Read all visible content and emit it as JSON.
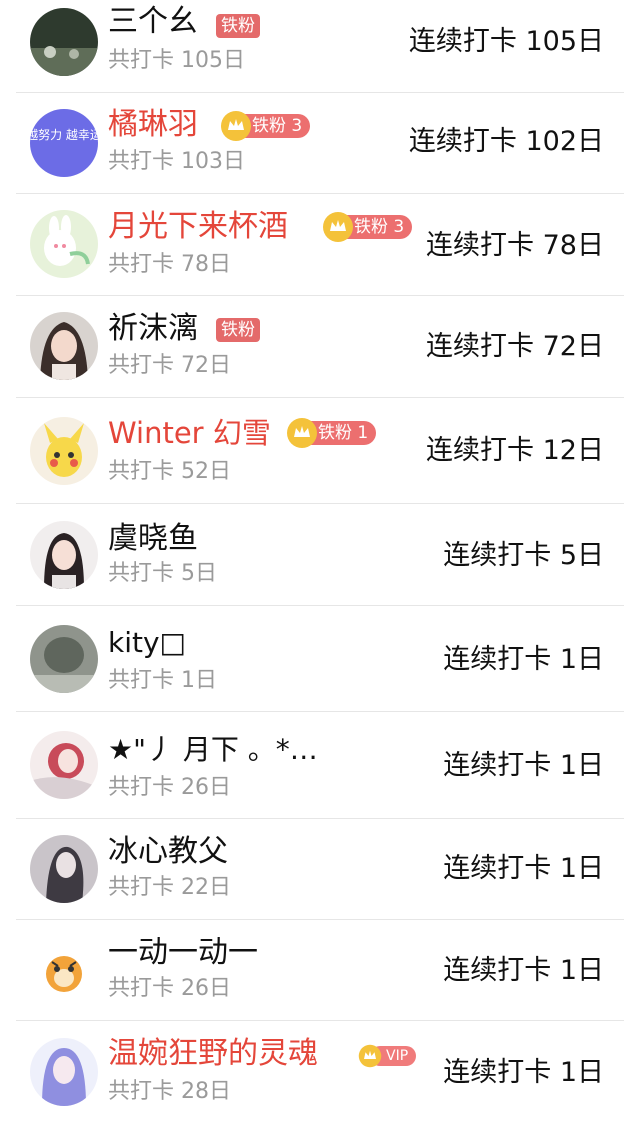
{
  "rows": [
    {
      "name": "三个幺",
      "total": "共打卡 105日",
      "streak": "连续打卡 105日",
      "badge": "铁粉"
    },
    {
      "name": "橘琳羽",
      "total": "共打卡 103日",
      "streak": "连续打卡 102日",
      "badge": "铁粉 3"
    },
    {
      "name": "月光下来杯酒",
      "total": "共打卡 78日",
      "streak": "连续打卡 78日",
      "badge": "铁粉 3"
    },
    {
      "name": "祈沫漓",
      "total": "共打卡 72日",
      "streak": "连续打卡 72日",
      "badge": "铁粉"
    },
    {
      "name": "Winter 幻雪",
      "total": "共打卡 52日",
      "streak": "连续打卡 12日",
      "badge": "铁粉 1"
    },
    {
      "name": "虞晓鱼",
      "total": "共打卡 5日",
      "streak": "连续打卡 5日"
    },
    {
      "name": "kity□",
      "total": "共打卡 1日",
      "streak": "连续打卡 1日"
    },
    {
      "name": "★\"丿 月下 。*…",
      "total": "共打卡 26日",
      "streak": "连续打卡 1日"
    },
    {
      "name": "冰心教父",
      "total": "共打卡 22日",
      "streak": "连续打卡 1日"
    },
    {
      "name": "一动一动一",
      "total": "共打卡 26日",
      "streak": "连续打卡 1日"
    },
    {
      "name": "温婉狂野的灵魂",
      "total": "共打卡 28日",
      "streak": "连续打卡 1日",
      "badge": "VIP"
    }
  ],
  "avatar_text": {
    "rows_1": "越努力 越幸运"
  },
  "colors": {
    "name_highlight": "#e4463a",
    "badge": "#e46a6a",
    "muted_text": "#9a9a9a"
  }
}
